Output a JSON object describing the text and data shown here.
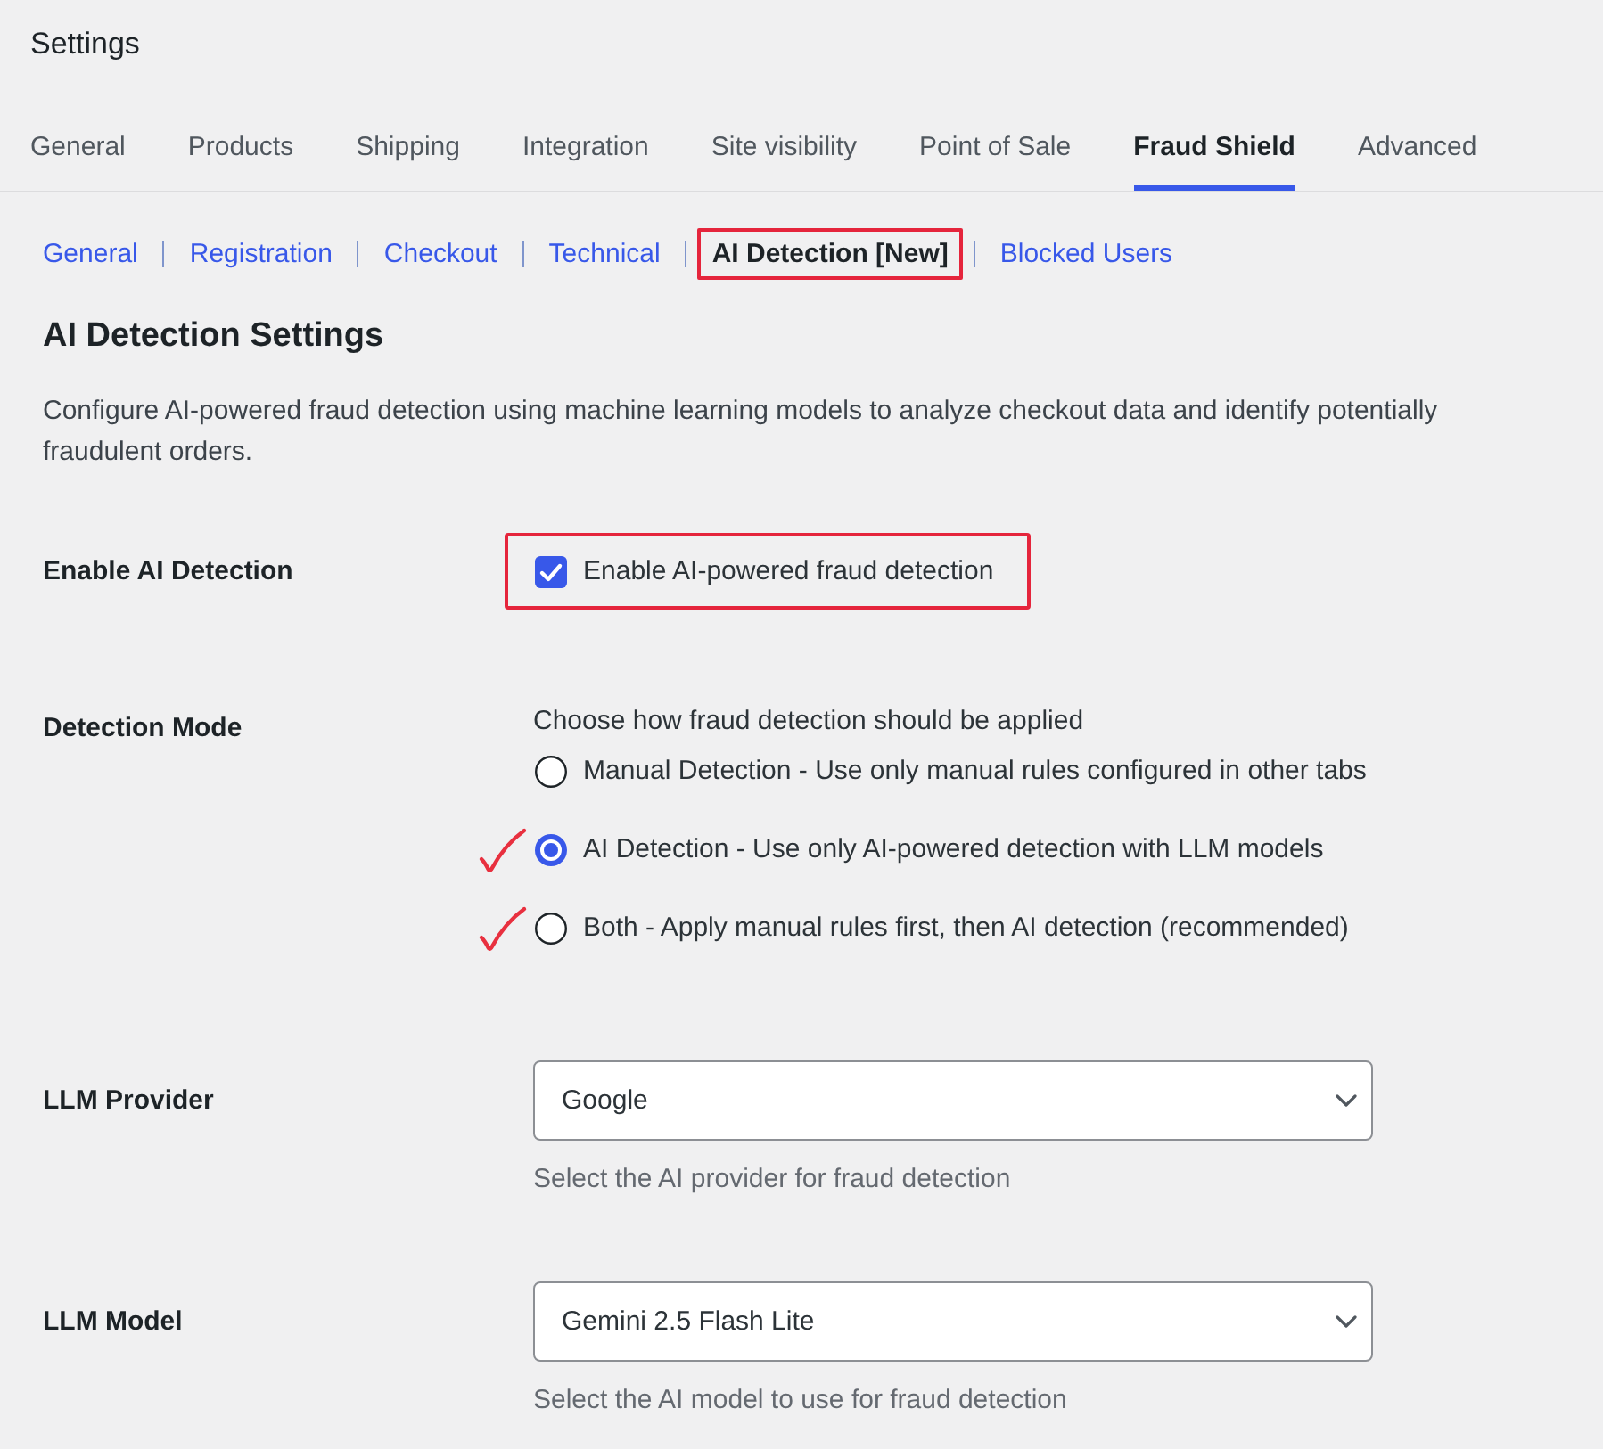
{
  "page": {
    "title": "Settings"
  },
  "tabs": [
    {
      "label": "General",
      "selected": false
    },
    {
      "label": "Products",
      "selected": false
    },
    {
      "label": "Shipping",
      "selected": false
    },
    {
      "label": "Integration",
      "selected": false
    },
    {
      "label": "Site visibility",
      "selected": false
    },
    {
      "label": "Point of Sale",
      "selected": false
    },
    {
      "label": "Fraud Shield",
      "selected": true
    },
    {
      "label": "Advanced",
      "selected": false
    }
  ],
  "subtabs": [
    {
      "label": "General",
      "selected": false,
      "highlighted": false
    },
    {
      "label": "Registration",
      "selected": false,
      "highlighted": false
    },
    {
      "label": "Checkout",
      "selected": false,
      "highlighted": false
    },
    {
      "label": "Technical",
      "selected": false,
      "highlighted": false
    },
    {
      "label": "AI Detection [New]",
      "selected": true,
      "highlighted": true
    },
    {
      "label": "Blocked Users",
      "selected": false,
      "highlighted": false
    }
  ],
  "section": {
    "title": "AI Detection Settings",
    "description": "Configure AI-powered fraud detection using machine learning models to analyze checkout data and identify potentially fraudulent orders."
  },
  "fields": [
    {
      "kind": "checkbox",
      "label": "Enable AI Detection",
      "option": "Enable AI-powered fraud detection",
      "checked": true,
      "highlighted": true
    },
    {
      "kind": "radio",
      "label": "Detection Mode",
      "description": "Choose how fraud detection should be applied",
      "options": [
        {
          "label": "Manual Detection - Use only manual rules configured in other tabs",
          "selected": false,
          "marked": false
        },
        {
          "label": "AI Detection - Use only AI-powered detection with LLM models",
          "selected": true,
          "marked": true
        },
        {
          "label": "Both - Apply manual rules first, then AI detection (recommended)",
          "selected": false,
          "marked": true
        }
      ]
    },
    {
      "kind": "select",
      "label": "LLM Provider",
      "value": "Google",
      "description": "Select the AI provider for fraud detection"
    },
    {
      "kind": "select",
      "label": "LLM Model",
      "value": "Gemini 2.5 Flash Lite",
      "description": "Select the AI model to use for fraud detection"
    }
  ]
}
